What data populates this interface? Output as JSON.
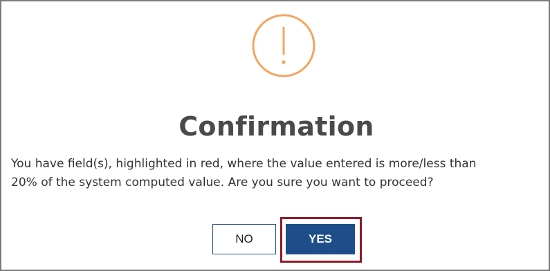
{
  "dialog": {
    "icon": "exclamation-circle-icon",
    "icon_color": "#f4a460",
    "title": "Confirmation",
    "message_lines": [
      "You have field(s), highlighted in red, where the value entered is more/less than",
      "20% of the system computed value. Are you sure you want to proceed?"
    ],
    "buttons": {
      "no_label": "NO",
      "yes_label": "YES"
    },
    "colors": {
      "title": "#4a4a4a",
      "yes_background": "#1d4e89",
      "yes_highlight_border": "#8c1a24",
      "no_border": "#1f4f8a"
    }
  }
}
